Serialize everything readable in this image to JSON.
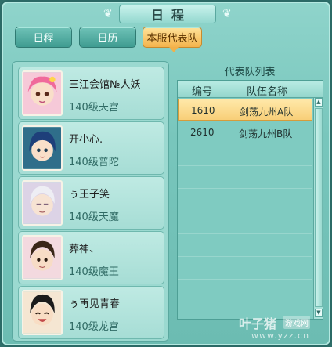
{
  "window": {
    "title": "日程"
  },
  "tabs": [
    {
      "label": "日程",
      "active": false
    },
    {
      "label": "日历",
      "active": false
    },
    {
      "label": "本服代表队",
      "active": true
    }
  ],
  "players": [
    {
      "name": "三江会馆№人妖",
      "level": "140级天宫",
      "avatar": "pink-hair-girl-avatar"
    },
    {
      "name": "开小心.",
      "level": "140级普陀",
      "avatar": "blue-hair-girl-avatar"
    },
    {
      "name": "ぅ王子笑",
      "level": "140级天魔",
      "avatar": "white-hair-boy-avatar"
    },
    {
      "name": "葬神、",
      "level": "140级魔王",
      "avatar": "brown-hair-boy-avatar"
    },
    {
      "name": "ぅ再见青春",
      "level": "140级龙宫",
      "avatar": "laughing-boy-avatar"
    }
  ],
  "team_list": {
    "title": "代表队列表",
    "columns": [
      "编号",
      "队伍名称"
    ],
    "rows": [
      {
        "id": "1610",
        "name": "剑荡九州A队",
        "selected": true
      },
      {
        "id": "2610",
        "name": "剑荡九州B队",
        "selected": false
      }
    ]
  },
  "watermark": {
    "main": "叶子猪",
    "tag": "游戏网",
    "url": "www.yzz.cn"
  },
  "colors": {
    "accent": "#f4b34c",
    "panel": "#78c6bc"
  }
}
